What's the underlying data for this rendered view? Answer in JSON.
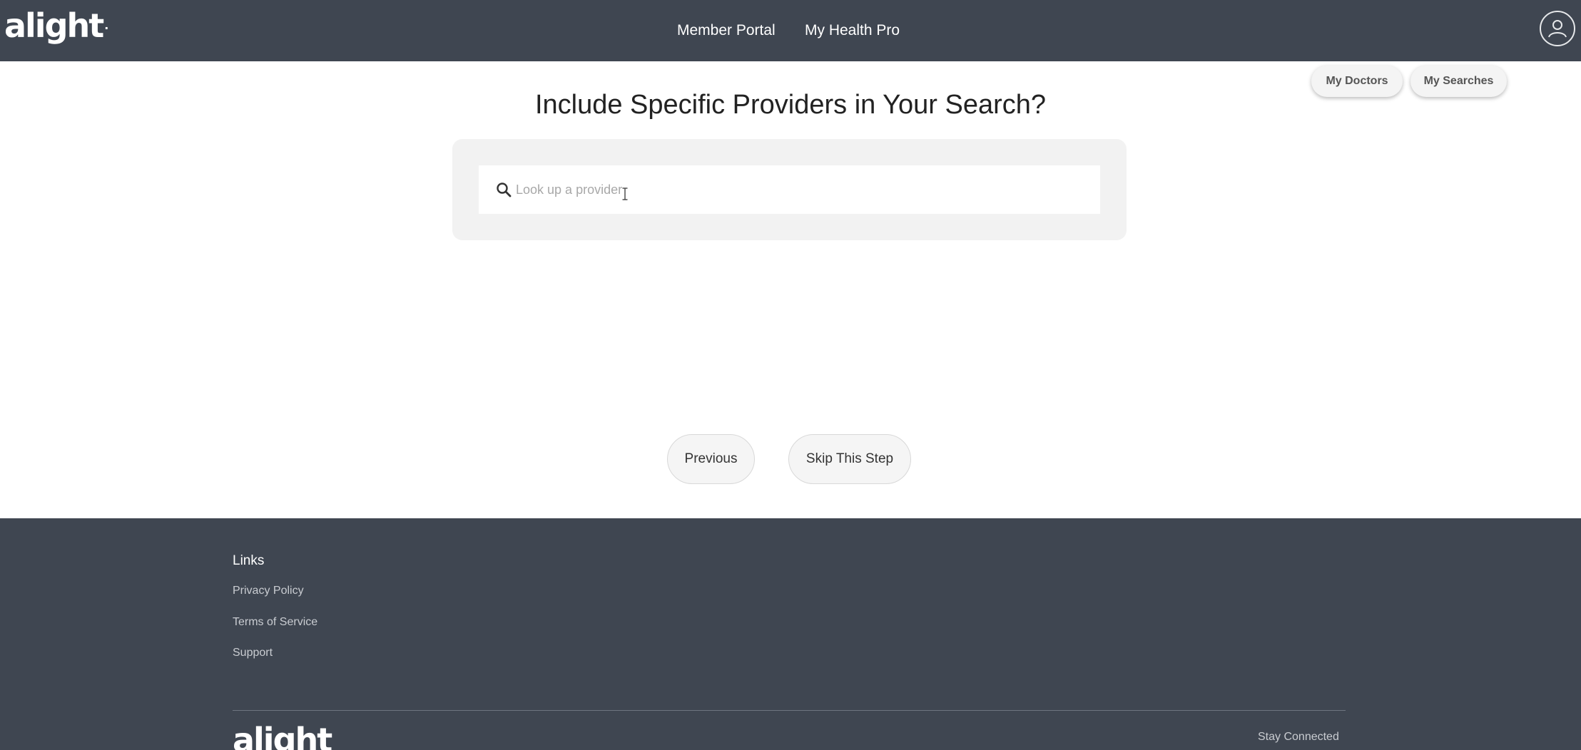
{
  "header": {
    "logo_text": "alight",
    "logo_mark": ".",
    "nav": [
      {
        "label": "Member Portal"
      },
      {
        "label": "My Health Pro"
      }
    ],
    "user_icon": "user-circle-icon"
  },
  "quick_links": {
    "my_doctors": "My Doctors",
    "my_searches": "My Searches"
  },
  "main": {
    "title": "Include Specific Providers in Your Search?",
    "search": {
      "placeholder": "Look up a provider",
      "value": "",
      "icon": "search-icon"
    }
  },
  "steps": {
    "previous": "Previous",
    "skip": "Skip This Step"
  },
  "footer": {
    "links_heading": "Links",
    "links": [
      "Privacy Policy",
      "Terms of Service",
      "Support"
    ],
    "logo_text": "alight",
    "stay_connected": "Stay Connected"
  },
  "colors": {
    "header_bg": "#3f4651",
    "footer_bg": "#3f4651",
    "card_bg": "#f2f2f2"
  }
}
